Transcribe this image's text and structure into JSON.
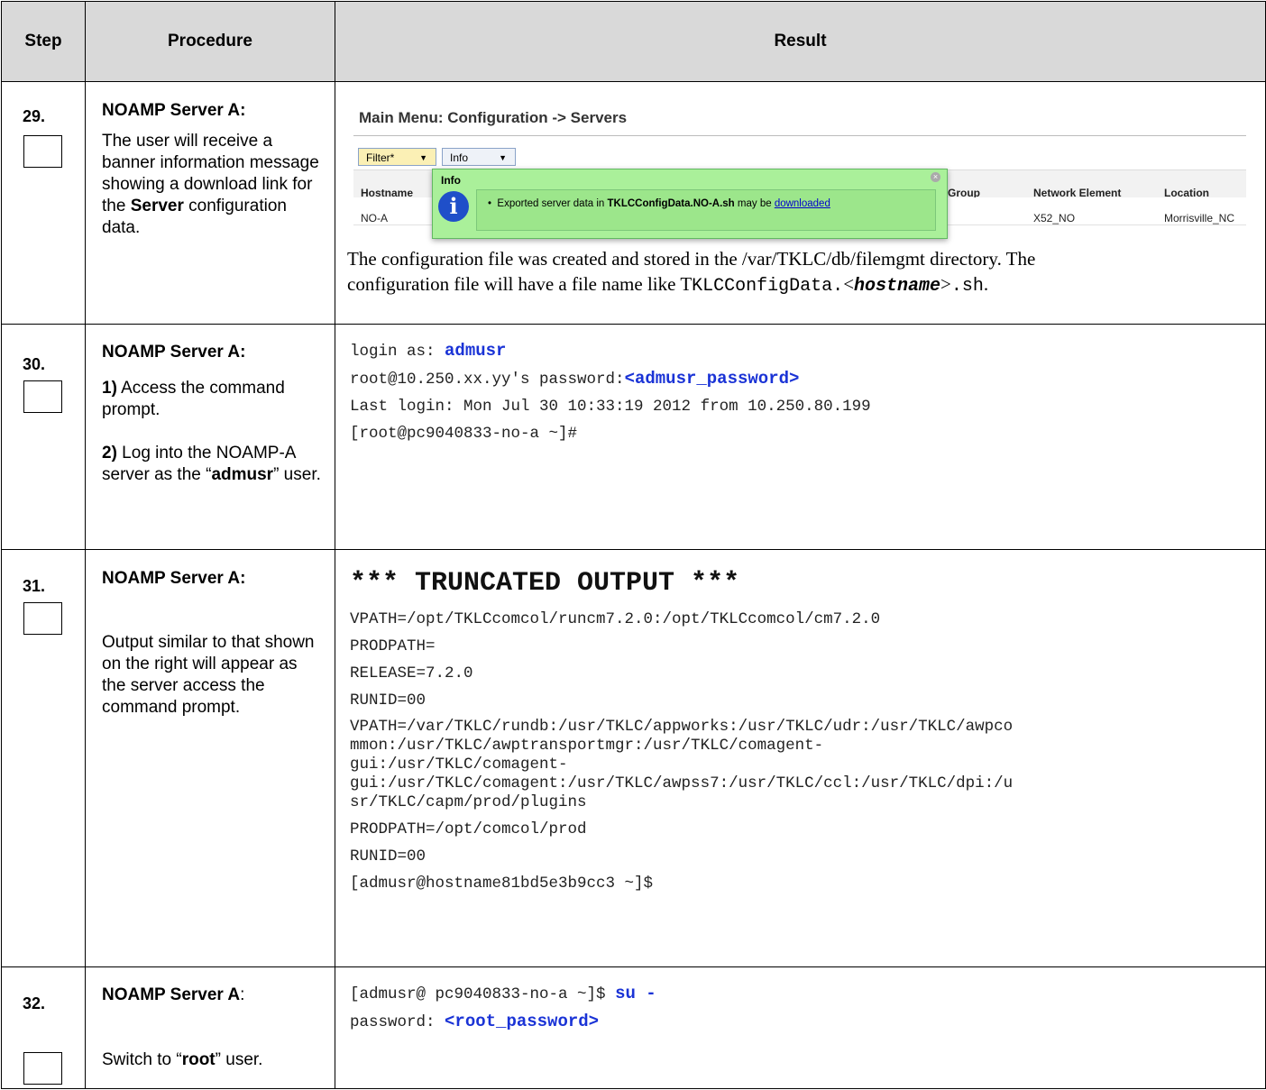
{
  "headers": {
    "step": "Step",
    "procedure": "Procedure",
    "result": "Result"
  },
  "steps": [
    {
      "number": "29.",
      "title": "NOAMP Server A:",
      "desc_1": "The user will receive a banner information message showing a download link for the ",
      "desc_bold": "Server",
      "desc_2": " configuration data.",
      "ui": {
        "menu_title": "Main Menu: Configuration -> Servers",
        "filter_btn": "Filter*",
        "info_btn": "Info",
        "columns": [
          "Hostname",
          "Group",
          "Network Element",
          "Location"
        ],
        "row": {
          "hostname": "NO-A",
          "network_element": "X52_NO",
          "location": "Morrisville_NC"
        },
        "popup_title": "Info",
        "popup_msg_pre": "Exported server data in ",
        "popup_msg_file": "TKLCConfigData.NO-A.sh",
        "popup_msg_mid": " may be ",
        "popup_link": "downloaded"
      },
      "result_line1": "The configuration file was created and stored in the /var/TKLC/db/filemgmt directory.  The",
      "result_line2_pre": "configuration file will have a file name like T",
      "result_line2_mono1": "KLCConfigData.",
      "result_line2_lt": "<",
      "result_line2_bold": "hostname",
      "result_line2_gt": ">",
      "result_line2_mono2": ".sh",
      "result_line2_end": "."
    },
    {
      "number": "30.",
      "title": "NOAMP Server A:",
      "sub1_num": "1)",
      "sub1_text": " Access the command prompt.",
      "sub2_num": "2)",
      "sub2_pre": " Log into the NOAMP-A server as the “",
      "sub2_bold": "admusr",
      "sub2_post": "” user.",
      "term": {
        "l1_pre": "login as: ",
        "l1_val": "admusr",
        "l2_pre": "root@10.250.xx.yy's password:",
        "l2_val": "<admusr_password>",
        "l3": "Last login: Mon Jul 30 10:33:19 2012 from 10.250.80.199",
        "l4": "[root@pc9040833-no-a ~]#"
      }
    },
    {
      "number": "31.",
      "title": "NOAMP Server A:",
      "desc": "Output similar to that shown on the right will appear as the server access the command prompt.",
      "banner": "*** TRUNCATED OUTPUT ***",
      "lines": [
        "VPATH=/opt/TKLCcomcol/runcm7.2.0:/opt/TKLCcomcol/cm7.2.0",
        "PRODPATH=",
        "RELEASE=7.2.0",
        "RUNID=00"
      ],
      "vpath_lines": [
        "VPATH=/var/TKLC/rundb:/usr/TKLC/appworks:/usr/TKLC/udr:/usr/TKLC/awpco",
        "mmon:/usr/TKLC/awptransportmgr:/usr/TKLC/comagent-",
        "gui:/usr/TKLC/comagent-",
        "gui:/usr/TKLC/comagent:/usr/TKLC/awpss7:/usr/TKLC/ccl:/usr/TKLC/dpi:/u",
        "sr/TKLC/capm/prod/plugins"
      ],
      "tail_lines": [
        "PRODPATH=/opt/comcol/prod",
        "RUNID=00",
        "[admusr@hostname81bd5e3b9cc3 ~]$"
      ]
    },
    {
      "number": "32.",
      "title": "NOAMP Server A",
      "title_colon": ":",
      "desc_pre": "Switch to “",
      "desc_bold": "root",
      "desc_post": "” user.",
      "term": {
        "l1_pre": "[admusr@ pc9040833-no-a ~]$ ",
        "l1_val": "su -",
        "l2_pre": "password: ",
        "l2_val": "<root_password>"
      }
    }
  ]
}
